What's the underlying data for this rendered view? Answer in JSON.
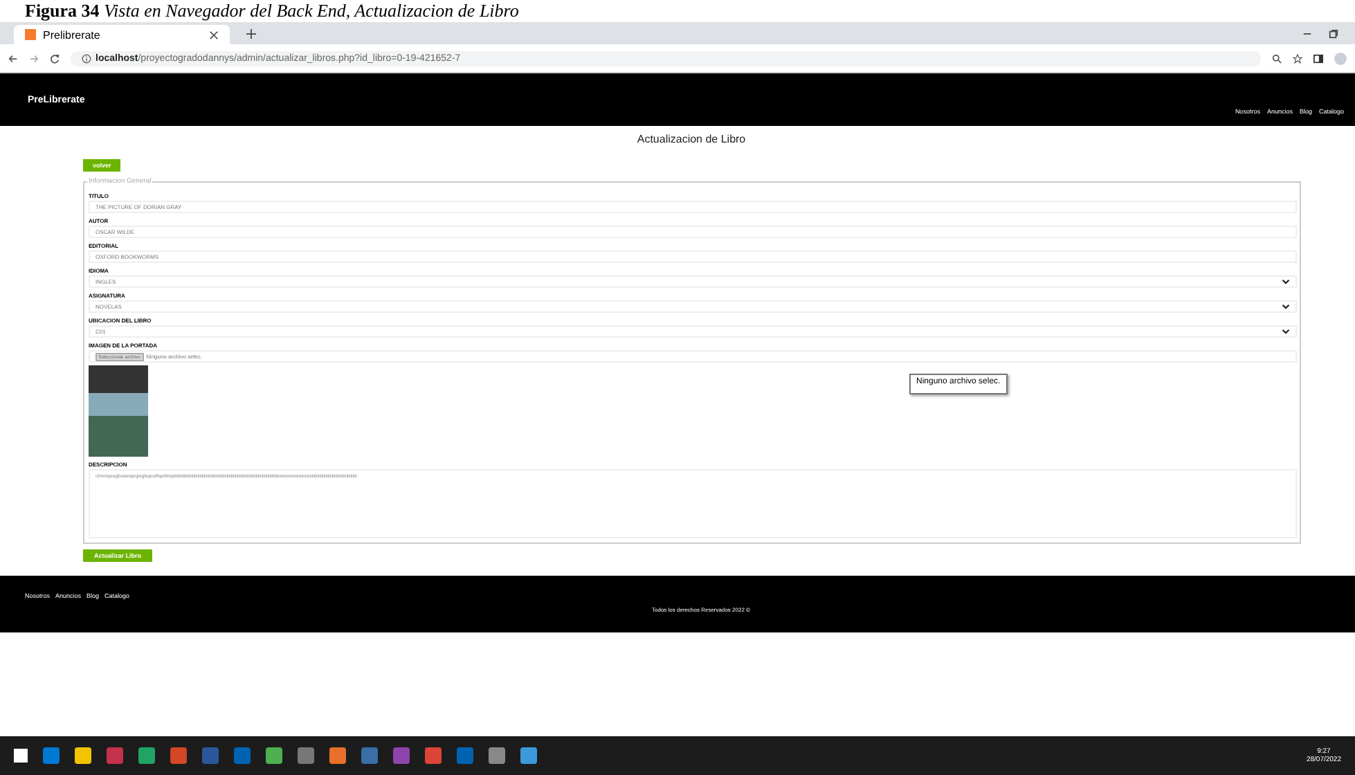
{
  "caption": {
    "number": "Figura 34",
    "text": "Vista en Navegador del Back End, Actualizacion de Libro"
  },
  "browser": {
    "tab_title": "Prelibrerate",
    "url_host": "localhost",
    "url_path": "/proyectogradodannys/admin/actualizar_libros.php?id_libro=0-19-421652-7"
  },
  "header": {
    "brand": "PreLibrerate",
    "nav": [
      "Nosotros",
      "Anuncios",
      "Blog",
      "Catalogo"
    ]
  },
  "page_title": "Actualizacion de Libro",
  "back_button": "volver",
  "fieldset": {
    "legend": "Informacion General",
    "fields": [
      {
        "label": "TITULO",
        "kind": "text",
        "value": "THE PICTURE OF DORIAN GRAY"
      },
      {
        "label": "AUTOR",
        "kind": "text",
        "value": "OSCAR WILDE"
      },
      {
        "label": "EDITORIAL",
        "kind": "text",
        "value": "OXFORD BOOKWORMS"
      },
      {
        "label": "IDIOMA",
        "kind": "select",
        "value": "INGLES"
      },
      {
        "label": "ASIGNATURA",
        "kind": "select",
        "value": "NOVELAS"
      },
      {
        "label": "UBICACION DEL LIBRO",
        "kind": "select",
        "value": "C01"
      },
      {
        "label": "IMAGEN DE LA PORTADA",
        "kind": "file",
        "button": "Seleccionar archivo",
        "value": "Ninguno archivo selec."
      }
    ],
    "tooltip": "Ninguno archivo selec.",
    "description_label": "DESCRIPCION",
    "description": "chnoiqeugbnaeiqeqiegbqeuifiqeifeiqiiiiiiiiiiiiiiiiiiiiiiiiiiiiiiiiiiiiiiiiiiiiiiiiiiiiiiiiiiiiiiiiiiiiiiiiiiiiiiiiiiiiiiiiiiiiiiiiieeeeeeeeeeeeiiiiiiiiiiiiiiiiiiiiiiiiiiiiiiiiiiiiiiiiiiii"
  },
  "submit_button": "Actualizar Libro",
  "footer": {
    "nav": [
      "Nosotros",
      "Anuncios",
      "Blog",
      "Catalogo"
    ],
    "copyright": "Todos los derechos Reservados 2022 ©"
  },
  "taskbar": {
    "time": "9:27",
    "date": "28/07/2022"
  }
}
